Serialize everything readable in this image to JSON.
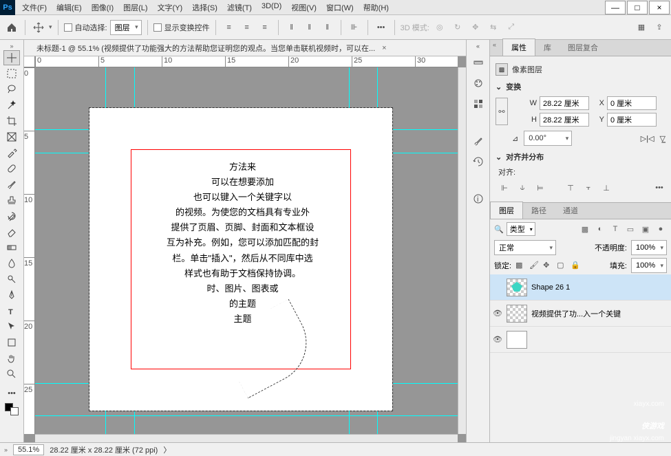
{
  "menu": {
    "file": "文件(F)",
    "edit": "编辑(E)",
    "image": "图像(I)",
    "layer": "图层(L)",
    "type": "文字(Y)",
    "select": "选择(S)",
    "filter": "滤镜(T)",
    "threeD": "3D(D)",
    "view": "视图(V)",
    "window": "窗口(W)",
    "help": "帮助(H)"
  },
  "options": {
    "autoSelect": "自动选择:",
    "autoSelTarget": "图层",
    "showTransform": "显示变换控件",
    "mode3d": "3D 模式:"
  },
  "doc": {
    "tab": "未标题-1 @ 55.1% (视频提供了功能强大的方法帮助您证明您的观点。当您单击联机视频时，可以在...",
    "zoom": "55.1%",
    "dim": "28.22 厘米 x 28.22 厘米 (72 ppi)"
  },
  "rulerH": [
    "0",
    "5",
    "10",
    "15",
    "20",
    "25",
    "30"
  ],
  "rulerV": [
    "0",
    "5",
    "10",
    "15",
    "20",
    "25"
  ],
  "leafText": "方法来\n可以在想要添加\n也可以键入一个关键字以\n的视频。为使您的文档具有专业外\n提供了页眉、页脚、封面和文本框设\n互为补充。例如，您可以添加匹配的封\n栏。单击\"插入\"，然后从不同库中选\n样式也有助于文档保持协调。\n时、图片、图表或\n的主题\n主题",
  "panels": {
    "propTab": "属性",
    "libTab": "库",
    "compTab": "图层复合",
    "pixelLayer": "像素图层",
    "transform": "变换",
    "w": "W",
    "wVal": "28.22 厘米",
    "x": "X",
    "xVal": "0 厘米",
    "h": "H",
    "hVal": "28.22 厘米",
    "y": "Y",
    "yVal": "0 厘米",
    "angle": "0.00°",
    "alignDistrib": "对齐并分布",
    "alignLabel": "对齐:",
    "layersTab": "图层",
    "pathsTab": "路径",
    "channelsTab": "通道",
    "filterKind": "类型",
    "blendMode": "正常",
    "opacityLabel": "不透明度:",
    "opacityVal": "100%",
    "lockLabel": "锁定:",
    "fillLabel": "填充:",
    "fillVal": "100%",
    "layer1": "Shape 26 1",
    "layer2": "视频提供了功...入一个关键"
  },
  "watermark": {
    "site": "xiayx.com",
    "sub": "jingyan xiayx.com",
    "brand": "侠游戏"
  }
}
